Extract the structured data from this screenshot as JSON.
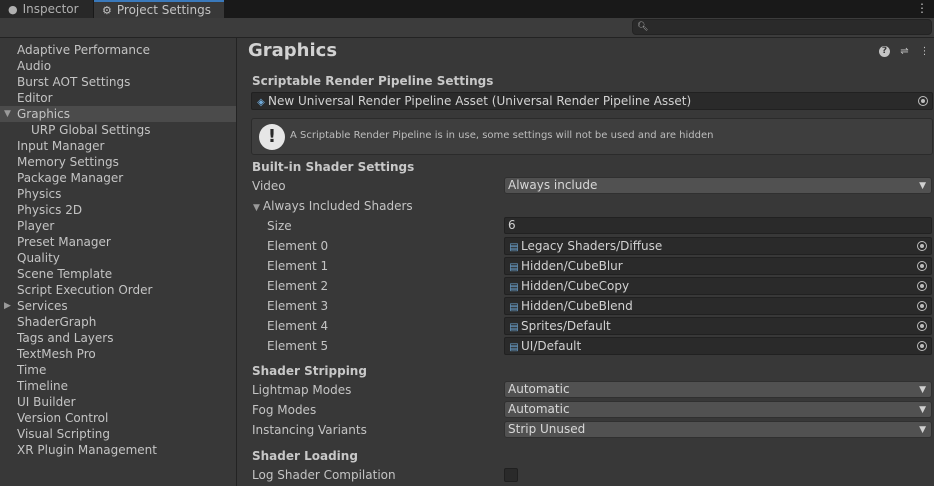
{
  "tabs": {
    "inspector": {
      "label": "Inspector",
      "icon": "info-circle-icon"
    },
    "project_settings": {
      "label": "Project Settings",
      "icon": "gear-icon"
    },
    "menu_icon": "kebab-menu-icon"
  },
  "search": {
    "placeholder": "",
    "icon": "search-icon"
  },
  "sidebar": {
    "items": [
      {
        "label": "Adaptive Performance"
      },
      {
        "label": "Audio"
      },
      {
        "label": "Burst AOT Settings"
      },
      {
        "label": "Editor"
      },
      {
        "label": "Graphics",
        "selected": true,
        "expanded": true
      },
      {
        "label": "URP Global Settings",
        "child": true
      },
      {
        "label": "Input Manager"
      },
      {
        "label": "Memory Settings"
      },
      {
        "label": "Package Manager"
      },
      {
        "label": "Physics"
      },
      {
        "label": "Physics 2D"
      },
      {
        "label": "Player"
      },
      {
        "label": "Preset Manager"
      },
      {
        "label": "Quality"
      },
      {
        "label": "Scene Template"
      },
      {
        "label": "Script Execution Order"
      },
      {
        "label": "Services",
        "collapsed": true
      },
      {
        "label": "ShaderGraph"
      },
      {
        "label": "Tags and Layers"
      },
      {
        "label": "TextMesh Pro"
      },
      {
        "label": "Time"
      },
      {
        "label": "Timeline"
      },
      {
        "label": "UI Builder"
      },
      {
        "label": "Version Control"
      },
      {
        "label": "Visual Scripting"
      },
      {
        "label": "XR Plugin Management"
      }
    ]
  },
  "main": {
    "title": "Graphics",
    "header_icons": [
      "help-icon",
      "presets-icon",
      "more-icon"
    ],
    "srp": {
      "heading": "Scriptable Render Pipeline Settings",
      "asset": "New Universal Render Pipeline Asset (Universal Render Pipeline Asset)",
      "warning": "A Scriptable Render Pipeline is in use, some settings will not be used and are hidden",
      "warning_glyph": "!"
    },
    "builtin": {
      "heading": "Built-in Shader Settings",
      "video_label": "Video",
      "video_value": "Always include",
      "always_included_label": "Always Included Shaders",
      "size_label": "Size",
      "size_value": "6",
      "elements": [
        {
          "label": "Element 0",
          "value": "Legacy Shaders/Diffuse"
        },
        {
          "label": "Element 1",
          "value": "Hidden/CubeBlur"
        },
        {
          "label": "Element 2",
          "value": "Hidden/CubeCopy"
        },
        {
          "label": "Element 3",
          "value": "Hidden/CubeBlend"
        },
        {
          "label": "Element 4",
          "value": "Sprites/Default"
        },
        {
          "label": "Element 5",
          "value": "UI/Default"
        }
      ]
    },
    "stripping": {
      "heading": "Shader Stripping",
      "lightmap_label": "Lightmap Modes",
      "lightmap_value": "Automatic",
      "fog_label": "Fog Modes",
      "fog_value": "Automatic",
      "instancing_label": "Instancing Variants",
      "instancing_value": "Strip Unused"
    },
    "loading": {
      "heading": "Shader Loading",
      "log_label": "Log Shader Compilation",
      "log_checked": false
    }
  },
  "colors": {
    "accent": "#3a79bb",
    "background": "#383838",
    "selection": "#4b4b4b"
  }
}
